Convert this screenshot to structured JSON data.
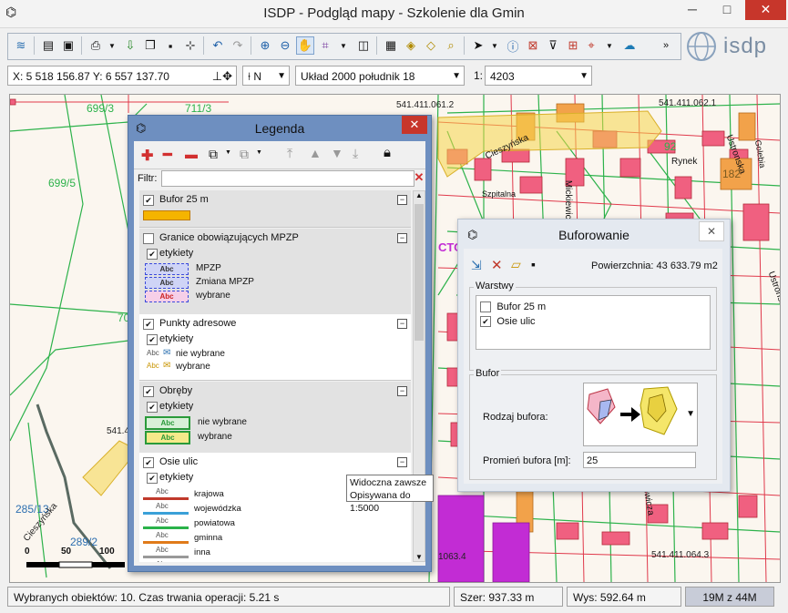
{
  "window": {
    "title": "ISDP - Podgląd mapy - Szkolenie dla Gmin",
    "minimize": "─",
    "maximize": "□",
    "close": "✕"
  },
  "logo": {
    "text": "isdp"
  },
  "coords": {
    "xy": "X: 5 518 156.87  Y: 6 557 137.70",
    "north": "N",
    "crs": "Układ 2000 południk 18",
    "scale_prefix": "1:",
    "scale": "4203"
  },
  "map": {
    "labels": [
      "699/3",
      "711/3",
      "699/5",
      "541.411.061.2",
      "541.411.062.1",
      "92",
      "Rynek",
      "Ustronska",
      "182",
      "Cieszyńska",
      "Szpitalna",
      "Mickiewicza",
      "Golebia",
      "70",
      "541.4",
      "285/13",
      "289/2",
      "Cieszyńska",
      "541.411.064.3",
      "Mickiewicza",
      "1063.4",
      "CTO",
      "Ustronska"
    ],
    "scalebar": {
      "labels": [
        "0",
        "50",
        "100"
      ]
    }
  },
  "legend": {
    "title": "Legenda",
    "filter_label": "Filtr:",
    "filter_value": "",
    "sections": [
      {
        "name": "Bufor 25 m",
        "checked": true
      },
      {
        "name": "Granice obowiązujących MPZP",
        "checked": false,
        "sub": "etykiety",
        "items": [
          "MPZP",
          "Zmiana MPZP",
          "wybrane"
        ]
      },
      {
        "name": "Punkty adresowe",
        "checked": true,
        "sub": "etykiety",
        "items": [
          "nie wybrane",
          "wybrane"
        ]
      },
      {
        "name": "Obręby",
        "checked": true,
        "sub": "etykiety",
        "items": [
          "nie wybrane",
          "wybrane"
        ]
      },
      {
        "name": "Osie ulic",
        "checked": true,
        "sub": "etykiety",
        "items": [
          "krajowa",
          "wojewódzka",
          "powiatowa",
          "gminna",
          "inna",
          "wybrane"
        ]
      }
    ],
    "abc": "Abc",
    "road_colors": [
      "#c0392b",
      "#3aa0d8",
      "#2ab24a",
      "#e07b1a",
      "#999999",
      "#f5c400"
    ]
  },
  "tooltip": {
    "line1": "Widoczna zawsze",
    "line2": "Opisywana do 1:5000"
  },
  "buffer": {
    "title": "Buforowanie",
    "area": "Powierzchnia: 43 633.79 m2",
    "layers_label": "Warstwy",
    "layers": [
      {
        "name": "Bufor 25 m",
        "checked": false
      },
      {
        "name": "Osie ulic",
        "checked": true
      }
    ],
    "buffer_group": "Bufor",
    "type_label": "Rodzaj bufora:",
    "radius_label": "Promień bufora [m]:",
    "radius_value": "25"
  },
  "status": {
    "message": "Wybranych obiektów: 10. Czas trwania operacji: 5.21 s",
    "width": "Szer: 937.33 m",
    "height": "Wys: 592.64 m",
    "memory": "19M z 44M"
  }
}
